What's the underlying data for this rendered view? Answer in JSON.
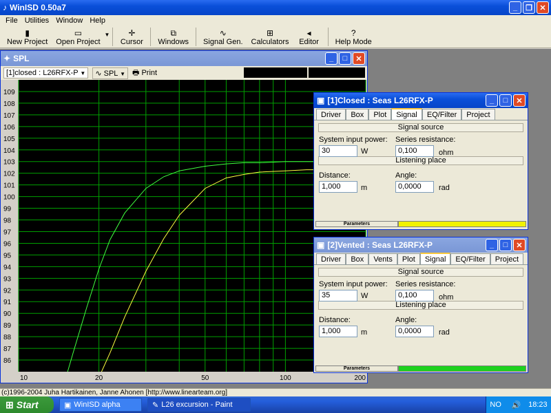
{
  "app": {
    "title": "WinISD 0.50a7"
  },
  "menu": [
    "File",
    "Utilities",
    "Window",
    "Help"
  ],
  "toolbar": [
    {
      "label": "New Project",
      "icon": "new-project-icon",
      "glyph": "▮"
    },
    {
      "label": "Open Project",
      "icon": "open-project-icon",
      "glyph": "📂"
    },
    {
      "label": "Cursor",
      "icon": "cursor-icon",
      "glyph": "✛"
    },
    {
      "label": "Windows",
      "icon": "windows-icon",
      "glyph": "⧉"
    },
    {
      "label": "Signal Gen.",
      "icon": "signal-gen-icon",
      "glyph": "∿"
    },
    {
      "label": "Calculators",
      "icon": "calculators-icon",
      "glyph": "⊞"
    },
    {
      "label": "Editor",
      "icon": "editor-icon",
      "glyph": "◂"
    },
    {
      "label": "Help Mode",
      "icon": "help-icon",
      "glyph": "?"
    }
  ],
  "spl_window": {
    "title": "SPL",
    "project_select": "[1]closed : L26RFX-P",
    "graph_select": "SPL",
    "print_label": "Print"
  },
  "chart_data": {
    "type": "line",
    "x_scale": "log",
    "xlim": [
      10,
      200
    ],
    "ylim": [
      85,
      110
    ],
    "x_ticks": [
      10,
      20,
      50,
      100,
      200
    ],
    "y_ticks": [
      86,
      87,
      88,
      89,
      90,
      91,
      92,
      93,
      94,
      95,
      96,
      97,
      98,
      99,
      100,
      101,
      102,
      103,
      104,
      105,
      106,
      107,
      108,
      109
    ],
    "grid": true,
    "colors": {
      "background": "#000000",
      "grid": "#00a000",
      "axis": "#d4d0c8"
    },
    "series": [
      {
        "color": "#40ff40",
        "x": [
          15,
          16,
          18,
          20,
          22,
          25,
          30,
          35,
          40,
          50,
          60,
          70,
          80,
          100,
          120,
          150,
          200
        ],
        "y": [
          84.4,
          86.6,
          90.5,
          93.8,
          96.3,
          98.6,
          100.7,
          101.7,
          102.2,
          102.6,
          102.8,
          102.9,
          102.9,
          103.0,
          103.0,
          103.0,
          103.0
        ]
      },
      {
        "color": "#ffff40",
        "x": [
          20,
          22,
          25,
          30,
          35,
          40,
          50,
          60,
          70,
          80,
          100,
          120,
          150,
          200
        ],
        "y": [
          84.5,
          86.6,
          89.7,
          93.6,
          96.4,
          98.4,
          100.7,
          101.6,
          101.9,
          102.1,
          102.2,
          102.3,
          102.3,
          102.3
        ]
      }
    ]
  },
  "closed_window": {
    "title": "[1]Closed : Seas  L26RFX-P",
    "tabs": [
      "Driver",
      "Box",
      "Plot",
      "Signal",
      "EQ/Filter",
      "Project"
    ],
    "active_tab": "Signal",
    "signal_source": "Signal source",
    "system_input_power_label": "System input power:",
    "system_input_power": "30",
    "power_unit": "W",
    "series_resistance_label": "Series resistance:",
    "series_resistance": "0,100",
    "resistance_unit": "ohm",
    "listening_place": "Listening place",
    "distance_label": "Distance:",
    "distance": "1,000",
    "distance_unit": "m",
    "angle_label": "Angle:",
    "angle": "0,0000",
    "angle_unit": "rad",
    "params_label": "Parameters",
    "params_color": "#f2f200"
  },
  "vented_window": {
    "title": "[2]Vented : Seas  L26RFX-P",
    "tabs": [
      "Driver",
      "Box",
      "Vents",
      "Plot",
      "Signal",
      "EQ/Filter",
      "Project"
    ],
    "active_tab": "Signal",
    "signal_source": "Signal source",
    "system_input_power_label": "System input power:",
    "system_input_power": "35",
    "power_unit": "W",
    "series_resistance_label": "Series resistance:",
    "series_resistance": "0,100",
    "resistance_unit": "ohm",
    "listening_place": "Listening place",
    "distance_label": "Distance:",
    "distance": "1,000",
    "distance_unit": "m",
    "angle_label": "Angle:",
    "angle": "0,0000",
    "angle_unit": "rad",
    "params_label": "Parameters",
    "params_color": "#1ed21e"
  },
  "status_bar": "(c)1996-2004 Juha Hartikainen, Janne Ahonen [http://www.linearteam.org]",
  "taskbar": {
    "start": "Start",
    "tasks": [
      "WinISD alpha",
      "L26 excursion - Paint"
    ],
    "lang": "NO",
    "clock": "18:23"
  }
}
